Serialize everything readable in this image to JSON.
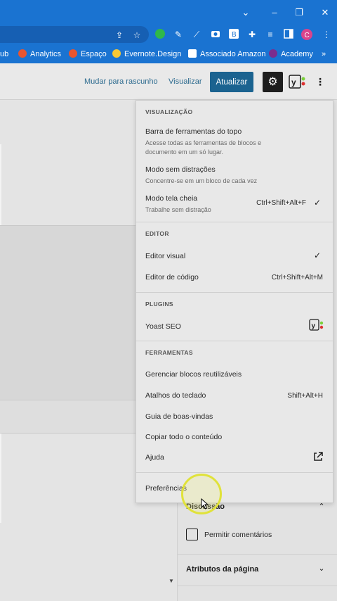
{
  "browser": {
    "bookmarks": [
      {
        "label": "ub",
        "icon": "",
        "color": ""
      },
      {
        "label": "Analytics",
        "icon": "analytics-flame-icon",
        "color": "#e8552f"
      },
      {
        "label": "Espaço",
        "icon": "flame-icon",
        "color": "#e8552f"
      },
      {
        "label": "Evernote.Design",
        "icon": "evernote-icon",
        "color": "#f7c833"
      },
      {
        "label": "Associado Amazon",
        "icon": "amazon-icon",
        "color": "#ffffff"
      },
      {
        "label": "Academy",
        "icon": "academy-icon",
        "color": "#7b2d8e"
      }
    ],
    "more_bookmarks": "»",
    "profile_initial": "C"
  },
  "toolbar": {
    "switch_to_draft": "Mudar para rascunho",
    "preview": "Visualizar",
    "update": "Atualizar"
  },
  "menu": {
    "view": {
      "title": "VISUALIZAÇÃO",
      "items": [
        {
          "label": "Barra de ferramentas do topo",
          "desc": "Acesse todas as ferramentas de blocos e documento em um só lugar.",
          "shortcut": "",
          "checked": false
        },
        {
          "label": "Modo sem distrações",
          "desc": "Concentre-se em um bloco de cada vez",
          "shortcut": "",
          "checked": false
        },
        {
          "label": "Modo tela cheia",
          "desc": "Trabalhe sem distração",
          "shortcut": "Ctrl+Shift+Alt+F",
          "checked": true
        }
      ]
    },
    "editor": {
      "title": "EDITOR",
      "items": [
        {
          "label": "Editor visual",
          "shortcut": "",
          "checked": true
        },
        {
          "label": "Editor de código",
          "shortcut": "Ctrl+Shift+Alt+M",
          "checked": false
        }
      ]
    },
    "plugins": {
      "title": "PLUGINS",
      "items": [
        {
          "label": "Yoast SEO",
          "icon": "yoast-icon"
        }
      ]
    },
    "tools": {
      "title": "FERRAMENTAS",
      "items": [
        {
          "label": "Gerenciar blocos reutilizáveis",
          "shortcut": ""
        },
        {
          "label": "Atalhos do teclado",
          "shortcut": "Shift+Alt+H"
        },
        {
          "label": "Guia de boas-vindas",
          "shortcut": ""
        },
        {
          "label": "Copiar todo o conteúdo",
          "shortcut": ""
        },
        {
          "label": "Ajuda",
          "shortcut": "",
          "icon": "external-link-icon"
        }
      ]
    },
    "preferences": "Preferências"
  },
  "sidebar": {
    "discussion": {
      "title": "Discussão",
      "allow_comments": "Permitir comentários",
      "allow_comments_checked": false
    },
    "page_attributes": "Atributos da página"
  },
  "colors": {
    "browser_blue": "#1a73d1",
    "primary_button": "#1b6390",
    "link": "#2d6b8f",
    "cursor_highlight": "#e0e23a"
  }
}
